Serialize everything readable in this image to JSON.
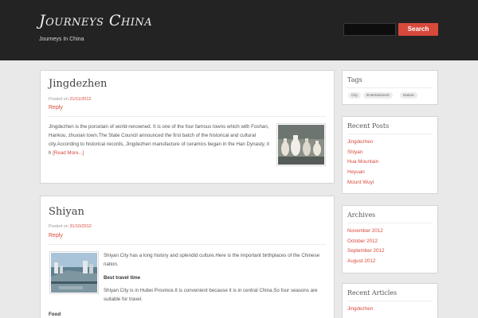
{
  "header": {
    "site_title": "Journeys China",
    "tagline": "Journeys In China",
    "search_button": "Search"
  },
  "posts": [
    {
      "title": "Jingdezhen",
      "posted_on": "Posted on",
      "date": "21/11/2012",
      "reply": "Reply",
      "excerpt": "Jingdezhen is the porcelain of world-renowned. It is one of the four famous towns which with Foshan, Hankou, zhuxian town.The State Council announced the first batch of the historical and cultural city.According to historical records, Jingdezhen manufacture of ceramics began in the Han Dynasty, it h",
      "read_more": "[Read More...]"
    },
    {
      "title": "Shiyan",
      "posted_on": "Posted on",
      "date": "31/10/2012",
      "reply": "Reply",
      "intro": "Shiyan City has a long history and splendid culture.Here is the important birthplaces of the Chinese nation.",
      "subheading": "Best travel time",
      "body": "Shiyan City is in Hubei Province.It is convenient because it is in central China.So four seasons are suitable for travel.",
      "food_heading": "Food"
    }
  ],
  "sidebar": {
    "tags": {
      "title": "Tags",
      "items": [
        "City",
        "Entertainment",
        "Nature"
      ]
    },
    "recent_posts": {
      "title": "Recent Posts",
      "items": [
        "Jingdezhen",
        "Shiyan",
        "Hua Mountain",
        "Heyuan",
        "Mount Wuyi"
      ]
    },
    "archives": {
      "title": "Archives",
      "items": [
        "November 2012",
        "October 2012",
        "September 2012",
        "August 2012"
      ]
    },
    "recent_articles": {
      "title": "Recent Articles",
      "items": [
        "Jingdezhen"
      ]
    }
  },
  "colors": {
    "accent": "#d8493b",
    "header_bg": "#232323",
    "page_bg": "#e9e9e9"
  }
}
